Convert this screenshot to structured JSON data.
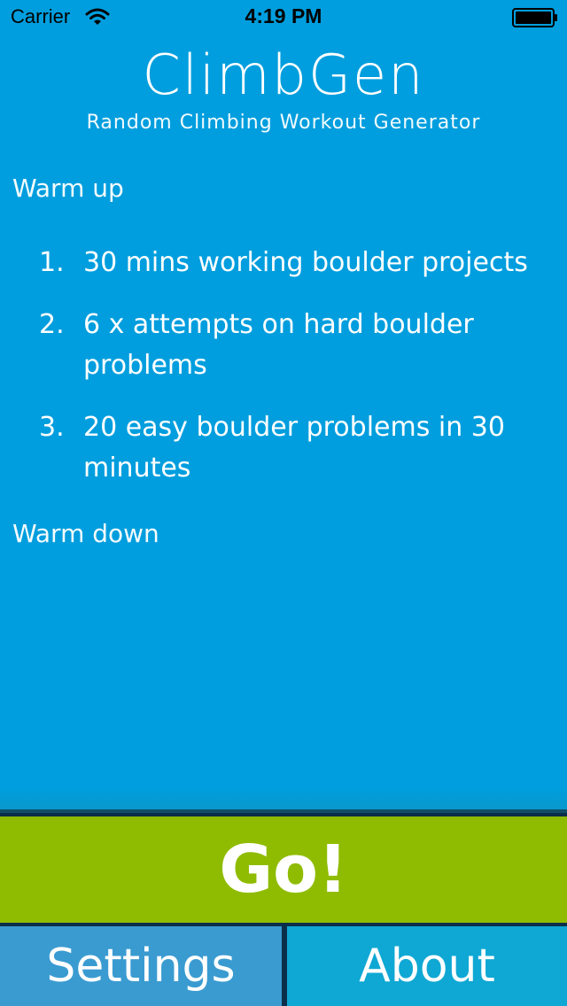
{
  "status_bar": {
    "carrier": "Carrier",
    "time": "4:19 PM",
    "wifi_icon": "wifi-icon",
    "battery_icon": "battery-icon"
  },
  "header": {
    "title": "ClimbGen",
    "subtitle": "Random Climbing Workout Generator"
  },
  "workout": {
    "warm_up_label": "Warm up",
    "exercises": [
      {
        "number": "1.",
        "text": "30 mins working boulder projects"
      },
      {
        "number": "2.",
        "text": "6 x attempts on hard boulder problems"
      },
      {
        "number": "3.",
        "text": "20 easy boulder problems in 30 minutes"
      }
    ],
    "warm_down_label": "Warm down"
  },
  "actions": {
    "go_label": "Go!",
    "settings_label": "Settings",
    "about_label": "About"
  },
  "colors": {
    "background": "#009ede",
    "go_button": "#8fbc00",
    "settings_button": "#3a9bd1",
    "about_button": "#0fa8d4",
    "divider": "#0b2f4a"
  }
}
